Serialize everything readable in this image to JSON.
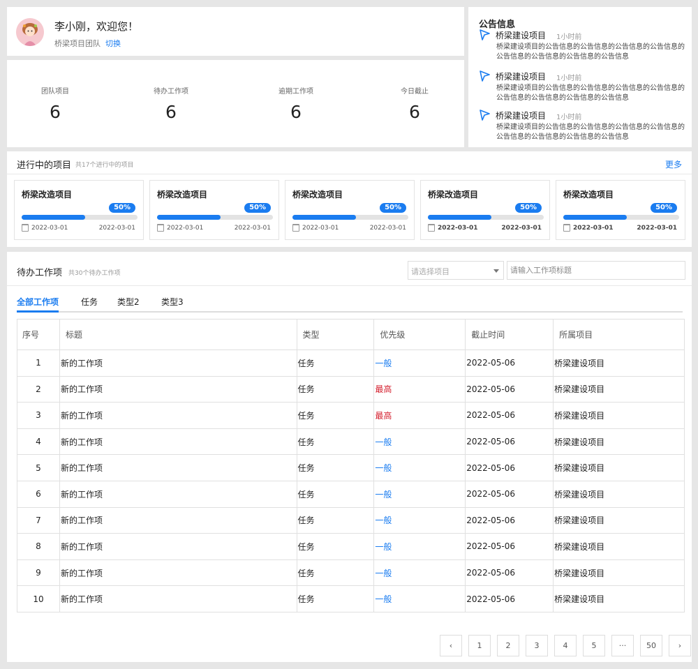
{
  "user": {
    "greeting": "李小刚，欢迎您！",
    "team": "桥梁项目团队",
    "switch_label": "切换"
  },
  "stats": [
    {
      "label": "团队项目",
      "value": "6"
    },
    {
      "label": "待办工作项",
      "value": "6"
    },
    {
      "label": "逾期工作项",
      "value": "6"
    },
    {
      "label": "今日截止",
      "value": "6"
    }
  ],
  "notices": {
    "title": "公告信息",
    "items": [
      {
        "title": "桥梁建设项目",
        "time": "1小时前",
        "body": "桥梁建设项目的公告信息的公告信息的公告信息的公告信息的公告信息的公告信息的公告信息的公告信息"
      },
      {
        "title": "桥梁建设项目",
        "time": "1小时前",
        "body": "桥梁建设项目的公告信息的公告信息的公告信息的公告信息的公告信息的公告信息的公告信息的公告信息"
      },
      {
        "title": "桥梁建设项目",
        "time": "1小时前",
        "body": "桥梁建设项目的公告信息的公告信息的公告信息的公告信息的公告信息的公告信息的公告信息的公告信息"
      }
    ]
  },
  "projects": {
    "title": "进行中的项目",
    "subtitle": "共17个进行中的项目",
    "more": "更多",
    "cards": [
      {
        "name": "桥梁改造项目",
        "progress_label": "50%",
        "progress": 0.55,
        "start": "2022-03-01",
        "end": "2022-03-01"
      },
      {
        "name": "桥梁改造项目",
        "progress_label": "50%",
        "progress": 0.55,
        "start": "2022-03-01",
        "end": "2022-03-01"
      },
      {
        "name": "桥梁改造项目",
        "progress_label": "50%",
        "progress": 0.55,
        "start": "2022-03-01",
        "end": "2022-03-01"
      },
      {
        "name": "桥梁改造项目",
        "progress_label": "50%",
        "progress": 0.55,
        "start": "2022-03-01",
        "end": "2022-03-01"
      },
      {
        "name": "桥梁改造项目",
        "progress_label": "50%",
        "progress": 0.55,
        "start": "2022-03-01",
        "end": "2022-03-01"
      }
    ]
  },
  "todo": {
    "title": "待办工作项",
    "subtitle": "共30个待办工作项",
    "select_placeholder": "请选择项目",
    "search_placeholder": "请输入工作项标题",
    "tabs": [
      "全部工作项",
      "任务",
      "类型2",
      "类型3"
    ],
    "columns": [
      "序号",
      "标题",
      "类型",
      "优先级",
      "截止时间",
      "所属项目"
    ],
    "rows": [
      {
        "no": "1",
        "title": "新的工作项",
        "type": "任务",
        "priority": "一般",
        "level": "low",
        "due": "2022-05-06",
        "project": "桥梁建设项目"
      },
      {
        "no": "2",
        "title": "新的工作项",
        "type": "任务",
        "priority": "最高",
        "level": "high",
        "due": "2022-05-06",
        "project": "桥梁建设项目"
      },
      {
        "no": "3",
        "title": "新的工作项",
        "type": "任务",
        "priority": "最高",
        "level": "high",
        "due": "2022-05-06",
        "project": "桥梁建设项目"
      },
      {
        "no": "4",
        "title": "新的工作项",
        "type": "任务",
        "priority": "一般",
        "level": "low",
        "due": "2022-05-06",
        "project": "桥梁建设项目"
      },
      {
        "no": "5",
        "title": "新的工作项",
        "type": "任务",
        "priority": "一般",
        "level": "low",
        "due": "2022-05-06",
        "project": "桥梁建设项目"
      },
      {
        "no": "6",
        "title": "新的工作项",
        "type": "任务",
        "priority": "一般",
        "level": "low",
        "due": "2022-05-06",
        "project": "桥梁建设项目"
      },
      {
        "no": "7",
        "title": "新的工作项",
        "type": "任务",
        "priority": "一般",
        "level": "low",
        "due": "2022-05-06",
        "project": "桥梁建设项目"
      },
      {
        "no": "8",
        "title": "新的工作项",
        "type": "任务",
        "priority": "一般",
        "level": "low",
        "due": "2022-05-06",
        "project": "桥梁建设项目"
      },
      {
        "no": "9",
        "title": "新的工作项",
        "type": "任务",
        "priority": "一般",
        "level": "low",
        "due": "2022-05-06",
        "project": "桥梁建设项目"
      },
      {
        "no": "10",
        "title": "新的工作项",
        "type": "任务",
        "priority": "一般",
        "level": "low",
        "due": "2022-05-06",
        "project": "桥梁建设项目"
      }
    ]
  },
  "pagination": {
    "prev": "‹",
    "pages": [
      "1",
      "2",
      "3",
      "4",
      "5",
      "···",
      "50"
    ],
    "next": "›"
  },
  "icons": {
    "notice": "megaphone-flag-icon",
    "date": "calendar-icon",
    "select": "caret-down-icon"
  },
  "colors": {
    "accent": "#1a7cf0",
    "danger": "#d4202f"
  }
}
